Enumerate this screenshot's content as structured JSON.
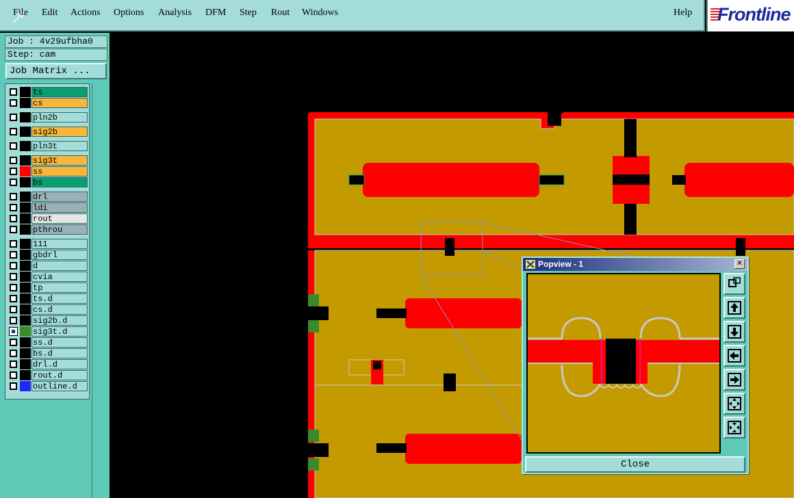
{
  "menu": {
    "items": [
      "File",
      "Edit",
      "Actions",
      "Options",
      "Analysis",
      "DFM",
      "Step",
      "Rout",
      "Windows"
    ],
    "help": "Help"
  },
  "brand": {
    "text": "Frontline"
  },
  "job": {
    "label": "Job : 4v29ufbha0",
    "step": "Step: cam",
    "matrix_button": "Job Matrix ..."
  },
  "layers": [
    {
      "name": "ts",
      "color": "#0b9e6e",
      "swatch": "#000000",
      "selected": false
    },
    {
      "name": "cs",
      "color": "#f8b63c",
      "swatch": "#000000",
      "selected": false
    },
    {
      "name": "pln2b",
      "color": "#a3dcd9",
      "swatch": "#000000",
      "selected": false
    },
    {
      "name": "sig2b",
      "color": "#f8b63c",
      "swatch": "#000000",
      "selected": false
    },
    {
      "name": "pln3t",
      "color": "#a3dcd9",
      "swatch": "#000000",
      "selected": false
    },
    {
      "name": "sig3t",
      "color": "#f8b63c",
      "swatch": "#000000",
      "selected": false
    },
    {
      "name": "ss",
      "color": "#f8b63c",
      "swatch": "#ff0000",
      "selected": false
    },
    {
      "name": "bs",
      "color": "#0b9e6e",
      "swatch": "#000000",
      "selected": false
    },
    {
      "name": "drl",
      "color": "#9cb0b8",
      "swatch": "#000000",
      "selected": false
    },
    {
      "name": "ldi",
      "color": "#9cb0b8",
      "swatch": "#000000",
      "selected": false
    },
    {
      "name": "rout",
      "color": "#e6e6e6",
      "swatch": "#000000",
      "selected": false
    },
    {
      "name": "pthrou",
      "color": "#9cb0b8",
      "swatch": "#000000",
      "selected": false
    },
    {
      "name": "111",
      "color": "#a3dcd9",
      "swatch": "#000000",
      "selected": false
    },
    {
      "name": "gbdrl",
      "color": "#a3dcd9",
      "swatch": "#000000",
      "selected": false
    },
    {
      "name": "d",
      "color": "#a3dcd9",
      "swatch": "#000000",
      "selected": false
    },
    {
      "name": "cvia",
      "color": "#a3dcd9",
      "swatch": "#000000",
      "selected": false
    },
    {
      "name": "tp",
      "color": "#a3dcd9",
      "swatch": "#000000",
      "selected": false
    },
    {
      "name": "ts.d",
      "color": "#a3dcd9",
      "swatch": "#000000",
      "selected": false
    },
    {
      "name": "cs.d",
      "color": "#a3dcd9",
      "swatch": "#000000",
      "selected": false
    },
    {
      "name": "sig2b.d",
      "color": "#a3dcd9",
      "swatch": "#000000",
      "selected": false
    },
    {
      "name": "sig3t.d",
      "color": "#a3dcd9",
      "swatch": "#3a8a2a",
      "selected": true
    },
    {
      "name": "ss.d",
      "color": "#a3dcd9",
      "swatch": "#000000",
      "selected": false
    },
    {
      "name": "bs.d",
      "color": "#a3dcd9",
      "swatch": "#000000",
      "selected": false
    },
    {
      "name": "drl.d",
      "color": "#a3dcd9",
      "swatch": "#000000",
      "selected": false
    },
    {
      "name": "rout.d",
      "color": "#a3dcd9",
      "swatch": "#000000",
      "selected": false
    },
    {
      "name": "outline.d",
      "color": "#a3dcd9",
      "swatch": "#1a2aff",
      "selected": false
    }
  ],
  "popview": {
    "title": "Popview - 1",
    "close_x": "✕",
    "close_button": "Close",
    "tools": [
      "zoom-fit-icon",
      "pan-up-icon",
      "pan-down-icon",
      "pan-left-icon",
      "pan-right-icon",
      "zoom-in-icon",
      "zoom-out-icon"
    ]
  },
  "colors": {
    "board": "#c39a00",
    "copper": "#ff0000",
    "rout": "#ff0000",
    "outline": "#c8c8c8",
    "menu_bg": "#a3dcd9",
    "panel_bg": "#5fcab7"
  }
}
